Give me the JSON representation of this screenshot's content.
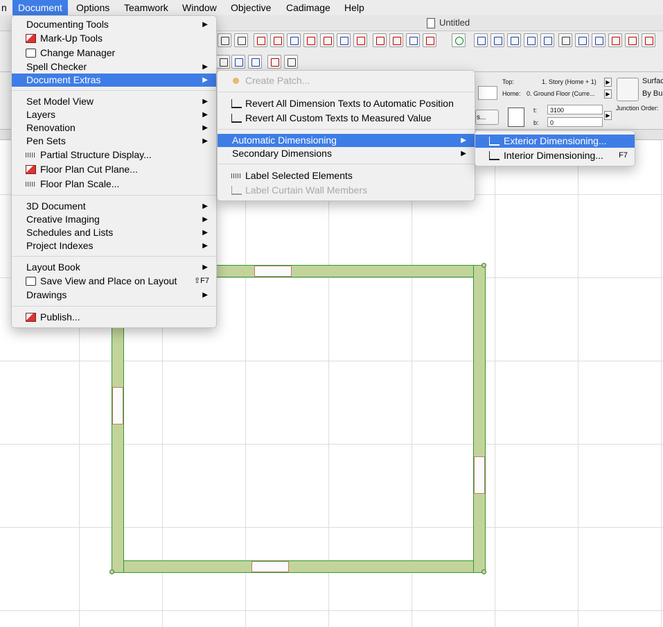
{
  "menubar": {
    "items": [
      "n",
      "Document",
      "Options",
      "Teamwork",
      "Window",
      "Objective",
      "Cadimage",
      "Help"
    ],
    "active": "Document"
  },
  "window": {
    "title": "Untitled"
  },
  "infobox": {
    "top_label": "Top:",
    "top_value": "1. Story (Home + 1)",
    "home_label": "Home:",
    "home_value": "0. Ground Floor (Curre...",
    "surface_label": "Surfac",
    "surface_value": "By Bu",
    "junction_label": "Junction Order:",
    "t_label": "t:",
    "t_value": "3100",
    "b_label": "b:",
    "b_value": "0",
    "btn_suffix": "s..."
  },
  "document_menu": {
    "items": [
      {
        "label": "Documenting Tools",
        "submenu": true
      },
      {
        "label": "Mark-Up Tools",
        "icon": "markup-icon"
      },
      {
        "label": "Change Manager",
        "icon": "change-manager-icon"
      },
      {
        "label": "Spell Checker",
        "submenu": true
      },
      {
        "label": "Document Extras",
        "submenu": true,
        "highlighted": true
      },
      {
        "label": "Set Model View",
        "submenu": true
      },
      {
        "label": "Layers",
        "submenu": true
      },
      {
        "label": "Renovation",
        "submenu": true
      },
      {
        "label": "Pen Sets",
        "submenu": true
      },
      {
        "label": "Partial Structure Display...",
        "icon": "partial-structure-icon"
      },
      {
        "label": "Floor Plan Cut Plane...",
        "icon": "cut-plane-icon"
      },
      {
        "label": "Floor Plan Scale...",
        "icon": "scale-icon"
      },
      {
        "label": "3D Document",
        "submenu": true
      },
      {
        "label": "Creative Imaging",
        "submenu": true
      },
      {
        "label": "Schedules and Lists",
        "submenu": true
      },
      {
        "label": "Project Indexes",
        "submenu": true
      },
      {
        "label": "Layout Book",
        "submenu": true
      },
      {
        "label": "Save View and Place on Layout",
        "icon": "save-view-icon",
        "shortcut": "⇧F7"
      },
      {
        "label": "Drawings",
        "submenu": true
      },
      {
        "label": "Publish...",
        "icon": "publish-icon"
      }
    ]
  },
  "extras_menu": {
    "items": [
      {
        "label": "Create Patch...",
        "icon": "patch-icon",
        "disabled": true
      },
      {
        "label": "Revert All Dimension Texts to Automatic Position",
        "icon": "revert-dimension-icon"
      },
      {
        "label": "Revert All Custom Texts to Measured Value",
        "icon": "revert-text-icon"
      },
      {
        "label": "Automatic Dimensioning",
        "submenu": true,
        "highlighted": true
      },
      {
        "label": "Secondary Dimensions",
        "submenu": true
      },
      {
        "label": "Label Selected Elements",
        "icon": "label-icon"
      },
      {
        "label": "Label Curtain Wall Members",
        "icon": "label-curtain-wall-icon",
        "disabled": true
      }
    ]
  },
  "autodim_menu": {
    "items": [
      {
        "label": "Exterior Dimensioning...",
        "icon": "exterior-dimension-icon",
        "highlighted": true
      },
      {
        "label": "Interior Dimensioning...",
        "icon": "interior-dimension-icon",
        "shortcut": "F7"
      }
    ]
  },
  "colors": {
    "highlight": "#3e7de6",
    "wall_fill": "#c3d49b",
    "wall_outline": "#2d9a2d"
  }
}
